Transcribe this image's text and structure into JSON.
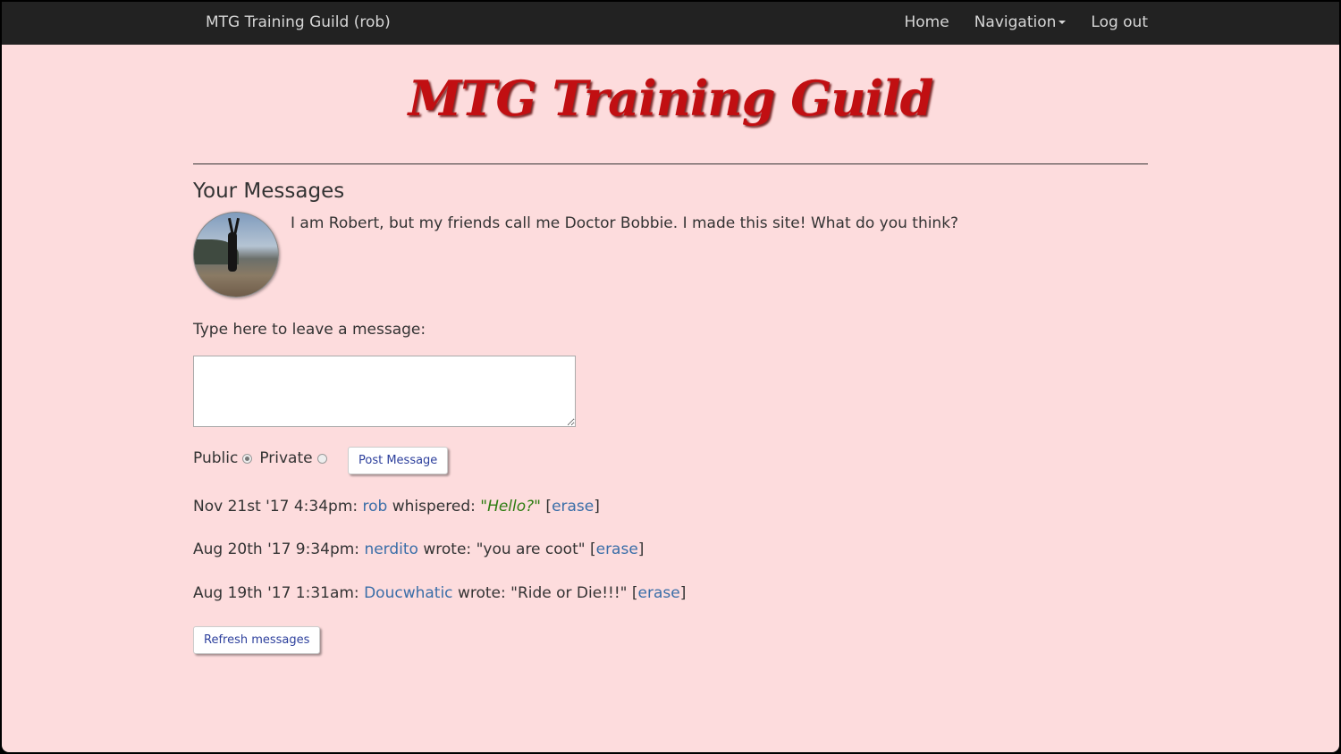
{
  "navbar": {
    "brand": "MTG Training Guild (rob)",
    "links": [
      "Home",
      "Navigation",
      "Log out"
    ]
  },
  "site_title": "MTG Training Guild",
  "heading": "Your Messages",
  "bio": "I am Robert, but my friends call me Doctor Bobbie. I made this site! What do you think?",
  "prompt": "Type here to leave a message:",
  "message_input": {
    "value": "",
    "placeholder": ""
  },
  "visibility": {
    "public_label": "Public",
    "private_label": "Private",
    "selected": "Public"
  },
  "post_button": "Post Message",
  "messages": [
    {
      "time": "Nov 21st '17 4:34pm:",
      "user": "rob",
      "verb": "whispered:",
      "text": "\"Hello?\"",
      "whisper": true,
      "erase": "erase"
    },
    {
      "time": "Aug 20th '17 9:34pm:",
      "user": "nerdito",
      "verb": "wrote:",
      "text": "\"you are coot\"",
      "whisper": false,
      "erase": "erase"
    },
    {
      "time": "Aug 19th '17 1:31am:",
      "user": "Doucwhatic",
      "verb": "wrote:",
      "text": "\"Ride or Die!!!\"",
      "whisper": false,
      "erase": "erase"
    }
  ],
  "refresh_button": "Refresh messages",
  "colors": {
    "page_bg": "#fddcdd",
    "navbar_bg": "#222222",
    "title": "#c10f12",
    "link": "#3a6ea8",
    "whisper": "#2e7d12"
  }
}
